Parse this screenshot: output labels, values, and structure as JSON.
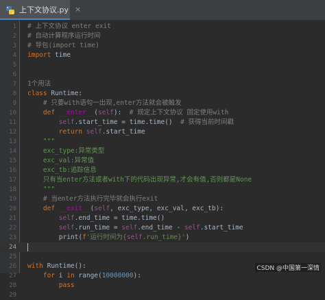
{
  "tab": {
    "label": "上下文协议.py",
    "close": "×"
  },
  "lines": [
    {
      "n": "1",
      "parts": [
        [
          "cm",
          "# 上下文协议 enter exit"
        ]
      ]
    },
    {
      "n": "2",
      "parts": [
        [
          "cm",
          "# 自动计算程序运行时间"
        ]
      ]
    },
    {
      "n": "3",
      "parts": [
        [
          "cm",
          "# 导包(import time)"
        ]
      ]
    },
    {
      "n": "4",
      "parts": [
        [
          "kw",
          "import"
        ],
        [
          "",
          " time"
        ]
      ]
    },
    {
      "n": "5",
      "parts": []
    },
    {
      "n": "6",
      "parts": []
    },
    {
      "n": "7",
      "parts": [
        [
          "cm",
          "1个用法"
        ]
      ],
      "hint": true
    },
    {
      "n": "8",
      "parts": [
        [
          "kw",
          "class"
        ],
        [
          "",
          " Runtime:"
        ]
      ]
    },
    {
      "n": "9",
      "parts": [
        [
          "",
          "    "
        ],
        [
          "cm",
          "# 只要with语句一出现,enter方法就会被触发"
        ]
      ]
    },
    {
      "n": "10",
      "parts": [
        [
          "",
          "    "
        ],
        [
          "kw",
          "def"
        ],
        [
          "",
          " "
        ],
        [
          "mg",
          "__enter__"
        ],
        [
          "",
          "("
        ],
        [
          "self",
          "self"
        ],
        [
          "",
          "):  "
        ],
        [
          "cm",
          "# 规定上下文协议 固定使用with"
        ]
      ]
    },
    {
      "n": "11",
      "parts": [
        [
          "",
          "        "
        ],
        [
          "self",
          "self"
        ],
        [
          "",
          ".start_time = time.time()  "
        ],
        [
          "cm",
          "# 获得当前时间戳"
        ]
      ]
    },
    {
      "n": "12",
      "parts": [
        [
          "",
          "        "
        ],
        [
          "kw",
          "return"
        ],
        [
          "",
          " "
        ],
        [
          "self",
          "self"
        ],
        [
          "",
          ".start_time"
        ]
      ]
    },
    {
      "n": "13",
      "parts": [
        [
          "",
          "    "
        ],
        [
          "doc",
          "\"\"\""
        ]
      ]
    },
    {
      "n": "14",
      "parts": [
        [
          "",
          "    "
        ],
        [
          "doc",
          "exc_type:异常类型"
        ]
      ]
    },
    {
      "n": "15",
      "parts": [
        [
          "",
          "    "
        ],
        [
          "doc",
          "exc_val:异常值"
        ]
      ]
    },
    {
      "n": "16",
      "parts": [
        [
          "",
          "    "
        ],
        [
          "doc",
          "exc_tb:追踪信息"
        ]
      ]
    },
    {
      "n": "17",
      "parts": [
        [
          "",
          "    "
        ],
        [
          "doc",
          "只有当enter方法或者with下的代码出现异常,才会有值,否则都是None"
        ]
      ]
    },
    {
      "n": "18",
      "parts": [
        [
          "",
          "    "
        ],
        [
          "doc",
          "\"\"\""
        ]
      ]
    },
    {
      "n": "19",
      "parts": [
        [
          "",
          "    "
        ],
        [
          "cm",
          "# 当enter方法执行完毕就会执行exit"
        ]
      ]
    },
    {
      "n": "20",
      "parts": [
        [
          "",
          "    "
        ],
        [
          "kw",
          "def"
        ],
        [
          "",
          " "
        ],
        [
          "mg",
          "__exit__"
        ],
        [
          "",
          "("
        ],
        [
          "self",
          "self"
        ],
        [
          "",
          ", exc_type, exc_val, exc_tb):"
        ]
      ]
    },
    {
      "n": "21",
      "parts": [
        [
          "",
          "        "
        ],
        [
          "self",
          "self"
        ],
        [
          "",
          ".end_time = time.time()"
        ]
      ]
    },
    {
      "n": "22",
      "parts": [
        [
          "",
          "        "
        ],
        [
          "self",
          "self"
        ],
        [
          "",
          ".run_time = "
        ],
        [
          "self",
          "self"
        ],
        [
          "",
          ".end_time - "
        ],
        [
          "self",
          "self"
        ],
        [
          "",
          ".start_time"
        ]
      ]
    },
    {
      "n": "23",
      "parts": [
        [
          "",
          "        print("
        ],
        [
          "fstr",
          "f"
        ],
        [
          "str",
          "'运行时间为{"
        ],
        [
          "self",
          "self"
        ],
        [
          "str",
          ".run_time}'"
        ],
        [
          "",
          ")"
        ]
      ]
    },
    {
      "n": "24",
      "parts": [],
      "current": true
    },
    {
      "n": "25",
      "parts": []
    },
    {
      "n": "26",
      "parts": [
        [
          "kw",
          "with"
        ],
        [
          "",
          " Runtime():"
        ]
      ]
    },
    {
      "n": "27",
      "parts": [
        [
          "",
          "    "
        ],
        [
          "kw",
          "for"
        ],
        [
          "",
          " i "
        ],
        [
          "kw",
          "in"
        ],
        [
          "",
          " range("
        ],
        [
          "num",
          "10000000"
        ],
        [
          "",
          "):"
        ]
      ]
    },
    {
      "n": "28",
      "parts": [
        [
          "",
          "        "
        ],
        [
          "kw",
          "pass"
        ]
      ]
    },
    {
      "n": "29",
      "parts": []
    }
  ],
  "watermark": "CSDN @中国第一深情",
  "colors": {
    "keyword": "#cc7832",
    "comment": "#808080",
    "docstring": "#629755",
    "self": "#94558d",
    "magic": "#b200b2",
    "string": "#6a8759",
    "number": "#6897bb",
    "text": "#a9b7c6"
  }
}
